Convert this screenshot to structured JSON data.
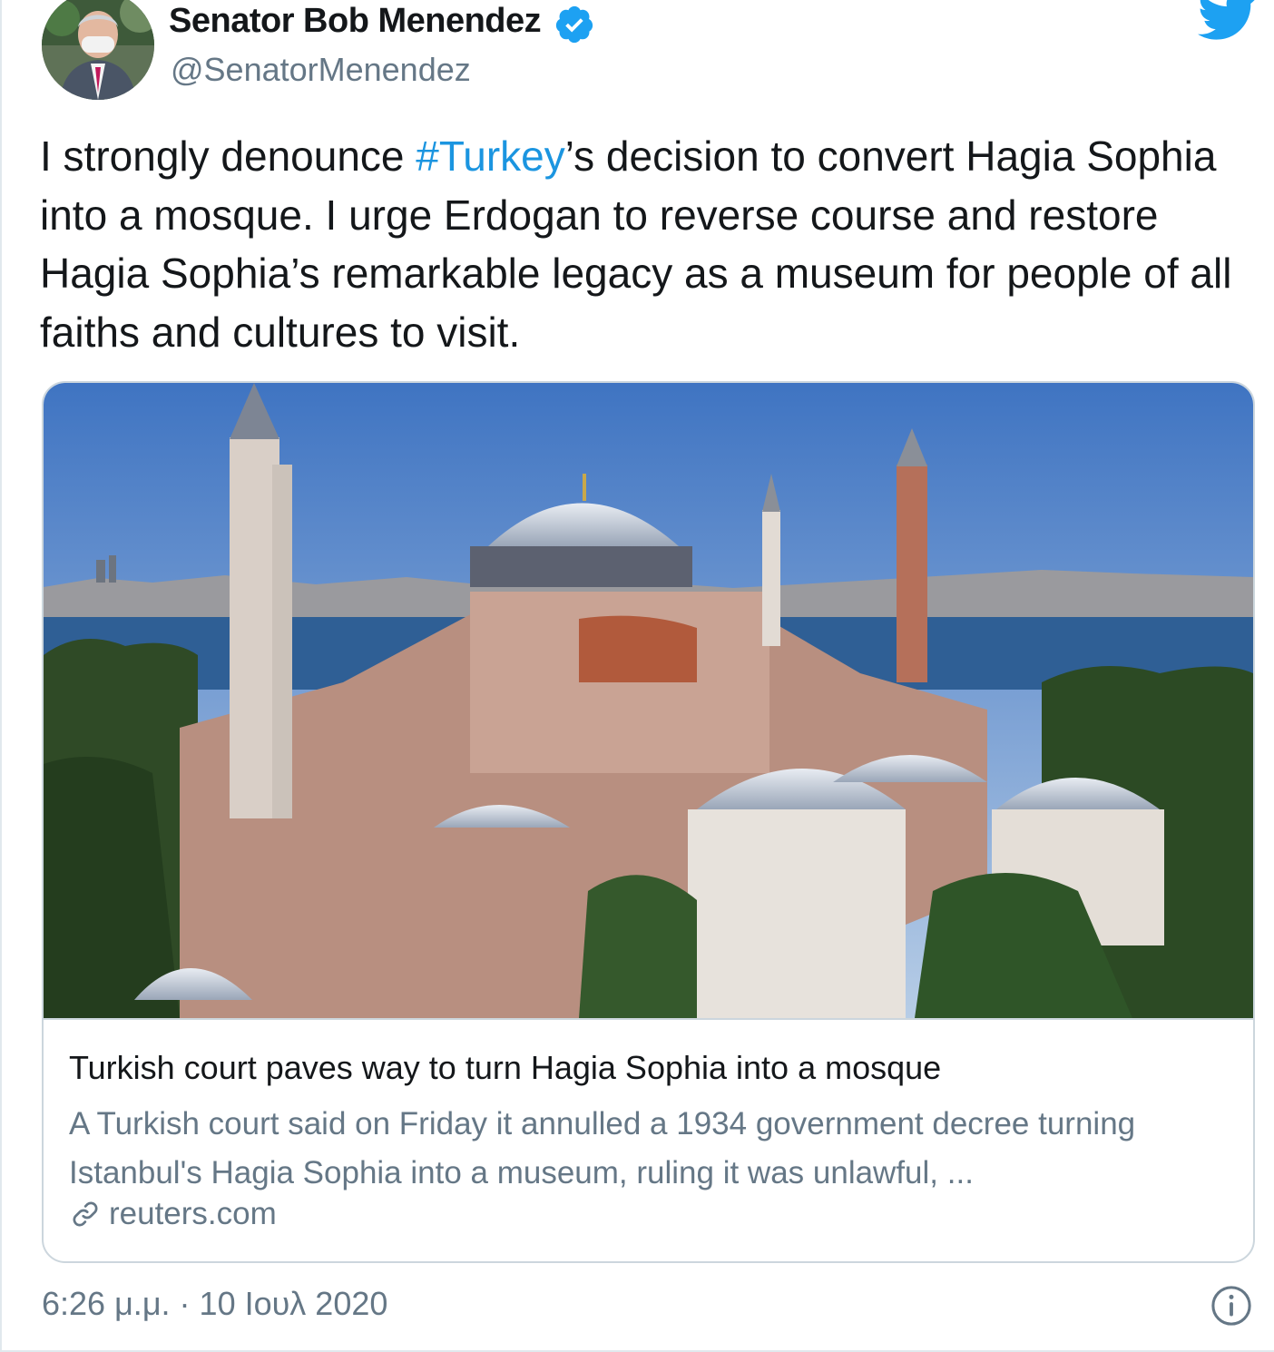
{
  "author": {
    "display_name": "Senator Bob Menendez",
    "handle": "@SenatorMenendez",
    "verified": true,
    "avatar_icon": "avatar-photo"
  },
  "brand": {
    "logo_icon": "twitter-bird-icon",
    "color": "#1da1f2"
  },
  "tweet": {
    "text_before": "I strongly denounce ",
    "hashtag": "#Turkey",
    "text_after": "’s decision to convert Hagia Sophia into a mosque. I urge Erdogan to reverse course and restore Hagia Sophia’s remarkable legacy as a museum for people of all faiths and cultures to visit.",
    "hashtag_color": "#1b95e0"
  },
  "card": {
    "image_icon": "hagia-sophia-photo",
    "title": "Turkish court paves way to turn Hagia Sophia into a mosque",
    "description": "A Turkish court said on Friday it annulled a 1934 government decree turning Istanbul's Hagia Sophia into a museum, ruling it was unlawful, ...",
    "domain": "reuters.com",
    "link_icon": "link-icon"
  },
  "footer": {
    "timestamp": "6:26 μ.μ. · 10 Ιουλ 2020",
    "info_icon": "info-icon"
  }
}
